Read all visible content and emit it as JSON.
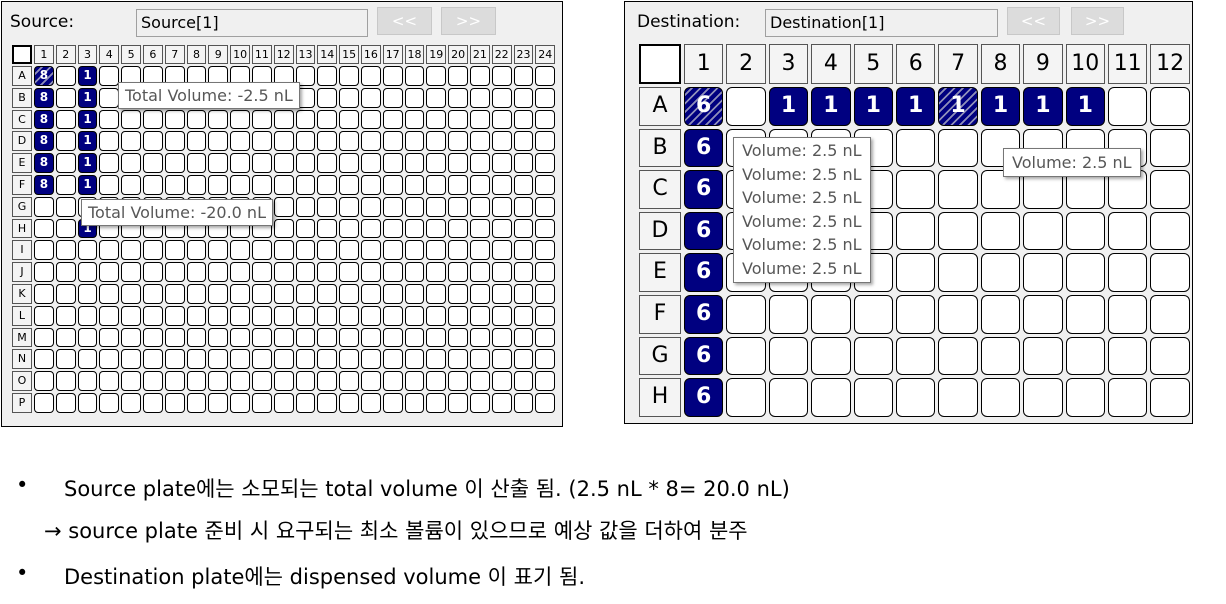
{
  "source": {
    "label": "Source:",
    "plate_name": "Source[1]",
    "prev_button": "<<",
    "next_button": ">>",
    "columns": [
      "1",
      "2",
      "3",
      "4",
      "5",
      "6",
      "7",
      "8",
      "9",
      "10",
      "11",
      "12",
      "13",
      "14",
      "15",
      "16",
      "17",
      "18",
      "19",
      "20",
      "21",
      "22",
      "23",
      "24"
    ],
    "rows": [
      "A",
      "B",
      "C",
      "D",
      "E",
      "F",
      "G",
      "H",
      "I",
      "J",
      "K",
      "L",
      "M",
      "N",
      "O",
      "P"
    ],
    "wells": [
      {
        "row": 0,
        "col": 0,
        "text": "8",
        "style": "hatched"
      },
      {
        "row": 0,
        "col": 2,
        "text": "1",
        "style": "filled"
      },
      {
        "row": 1,
        "col": 0,
        "text": "8",
        "style": "filled"
      },
      {
        "row": 1,
        "col": 2,
        "text": "1",
        "style": "filled"
      },
      {
        "row": 2,
        "col": 0,
        "text": "8",
        "style": "filled"
      },
      {
        "row": 2,
        "col": 2,
        "text": "1",
        "style": "filled"
      },
      {
        "row": 3,
        "col": 0,
        "text": "8",
        "style": "filled"
      },
      {
        "row": 3,
        "col": 2,
        "text": "1",
        "style": "filled"
      },
      {
        "row": 4,
        "col": 0,
        "text": "8",
        "style": "filled"
      },
      {
        "row": 4,
        "col": 2,
        "text": "1",
        "style": "filled"
      },
      {
        "row": 5,
        "col": 0,
        "text": "8",
        "style": "filled"
      },
      {
        "row": 5,
        "col": 2,
        "text": "1",
        "style": "filled"
      },
      {
        "row": 7,
        "col": 2,
        "text": "1",
        "style": "filled"
      }
    ],
    "tooltips": [
      "Total Volume: -2.5 nL",
      "Total Volume: -20.0 nL"
    ]
  },
  "destination": {
    "label": "Destination:",
    "plate_name": "Destination[1]",
    "prev_button": "<<",
    "next_button": ">>",
    "columns": [
      "1",
      "2",
      "3",
      "4",
      "5",
      "6",
      "7",
      "8",
      "9",
      "10",
      "11",
      "12"
    ],
    "rows": [
      "A",
      "B",
      "C",
      "D",
      "E",
      "F",
      "G",
      "H"
    ],
    "wells": [
      {
        "row": 0,
        "col": 0,
        "text": "6",
        "style": "hatched"
      },
      {
        "row": 0,
        "col": 2,
        "text": "1",
        "style": "filled"
      },
      {
        "row": 0,
        "col": 3,
        "text": "1",
        "style": "filled"
      },
      {
        "row": 0,
        "col": 4,
        "text": "1",
        "style": "filled"
      },
      {
        "row": 0,
        "col": 5,
        "text": "1",
        "style": "filled"
      },
      {
        "row": 0,
        "col": 6,
        "text": "1",
        "style": "hatched"
      },
      {
        "row": 0,
        "col": 7,
        "text": "1",
        "style": "filled"
      },
      {
        "row": 0,
        "col": 8,
        "text": "1",
        "style": "filled"
      },
      {
        "row": 0,
        "col": 9,
        "text": "1",
        "style": "filled"
      },
      {
        "row": 1,
        "col": 0,
        "text": "6",
        "style": "filled"
      },
      {
        "row": 2,
        "col": 0,
        "text": "6",
        "style": "filled"
      },
      {
        "row": 3,
        "col": 0,
        "text": "6",
        "style": "filled"
      },
      {
        "row": 4,
        "col": 0,
        "text": "6",
        "style": "filled"
      },
      {
        "row": 5,
        "col": 0,
        "text": "6",
        "style": "filled"
      },
      {
        "row": 6,
        "col": 0,
        "text": "6",
        "style": "filled"
      },
      {
        "row": 7,
        "col": 0,
        "text": "6",
        "style": "filled"
      }
    ],
    "tooltip_list": [
      "Volume: 2.5 nL",
      "Volume: 2.5 nL",
      "Volume: 2.5 nL",
      "Volume: 2.5 nL",
      "Volume: 2.5 nL",
      "Volume: 2.5 nL"
    ],
    "tooltip_single": "Volume: 2.5 nL"
  },
  "notes": {
    "bullet": "•",
    "line1": "Source plate에는 소모되는 total volume 이 산출 됨. (2.5 nL * 8= 20.0 nL)",
    "line2": "→ source plate 준비 시 요구되는 최소 볼륨이 있으므로 예상 값을 더하여 분주",
    "line3": "Destination plate에는 dispensed volume 이 표기 됨."
  },
  "colors": {
    "well_fill": "#000080",
    "panel_bg": "#f0f0f0"
  }
}
